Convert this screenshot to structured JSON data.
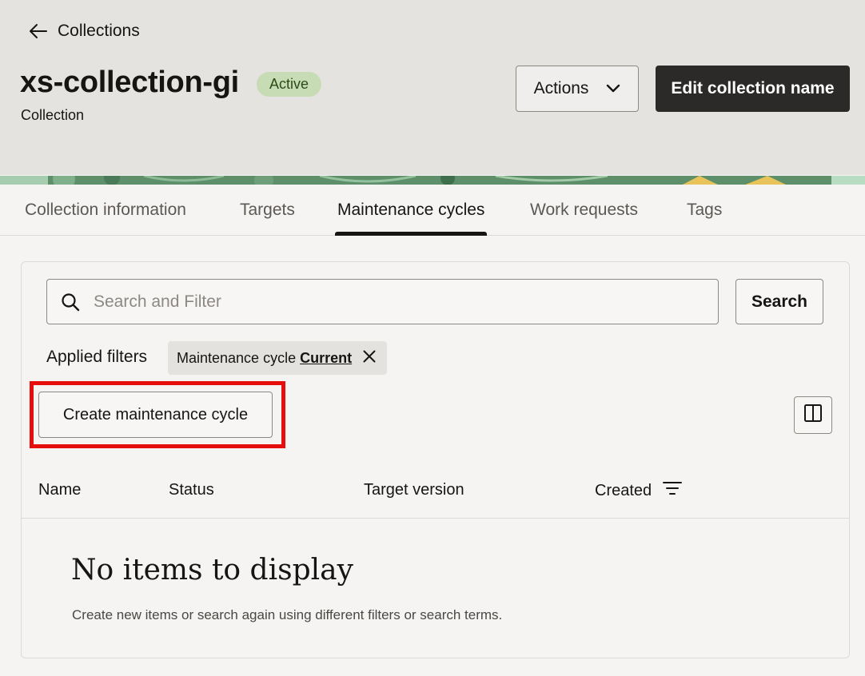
{
  "header": {
    "back_label": "Collections",
    "title": "xs-collection-gi",
    "status_badge": "Active",
    "subtitle": "Collection",
    "actions_label": "Actions",
    "edit_label": "Edit collection name"
  },
  "tabs": [
    {
      "label": "Collection information",
      "active": false
    },
    {
      "label": "Targets",
      "active": false
    },
    {
      "label": "Maintenance cycles",
      "active": true
    },
    {
      "label": "Work requests",
      "active": false
    },
    {
      "label": "Tags",
      "active": false
    }
  ],
  "search": {
    "placeholder": "Search and Filter",
    "value": "",
    "button_label": "Search"
  },
  "filters": {
    "label": "Applied filters",
    "chip_name": "Maintenance cycle",
    "chip_value": "Current"
  },
  "toolbar": {
    "create_label": "Create maintenance cycle"
  },
  "table": {
    "columns": [
      "Name",
      "Status",
      "Target version",
      "Created"
    ],
    "rows": []
  },
  "empty_state": {
    "title": "No items to display",
    "description": "Create new items or search again using different filters or search terms."
  },
  "colors": {
    "header_bg": "#e5e3df",
    "primary_button": "#2b2a28",
    "badge_bg": "#c7dcb5",
    "highlight": "#e60d0d"
  }
}
